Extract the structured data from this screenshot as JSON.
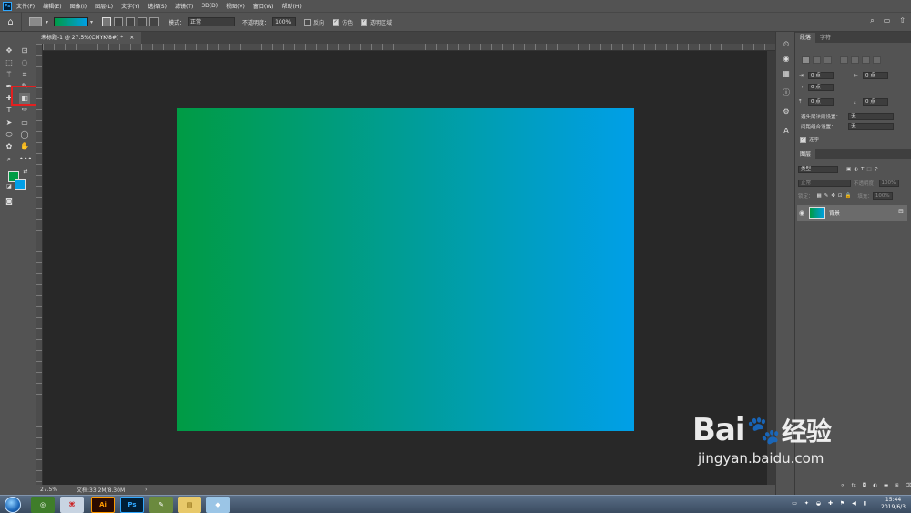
{
  "app": {
    "logo_text": "Ps"
  },
  "menu": [
    "文件(F)",
    "编辑(E)",
    "图像(I)",
    "图层(L)",
    "文字(Y)",
    "选择(S)",
    "滤镜(T)",
    "3D(D)",
    "视图(V)",
    "窗口(W)",
    "帮助(H)"
  ],
  "options": {
    "mode_label": "模式：",
    "mode_value": "正常",
    "opacity_label": "不透明度：",
    "opacity_value": "100%",
    "reverse_label": "反向",
    "dither_label": "仿色",
    "transparency_label": "透明区域",
    "reverse_checked": false,
    "dither_checked": true,
    "transparency_checked": true
  },
  "document": {
    "tab_title": "未标题-1 @ 27.5%(CMYK/8#) *",
    "close_glyph": "×",
    "gradient_start": "#009b44",
    "gradient_end": "#009fe8"
  },
  "status": {
    "zoom": "27.5%",
    "doc_info": "文档:33.2M/8.30M"
  },
  "paragraph_panel": {
    "tabs": [
      "段落",
      "字符"
    ],
    "indent_left": "0 点",
    "indent_right": "0 点",
    "indent_first": "0 点",
    "space_before": "0 点",
    "space_after": "0 点",
    "avoid_label": "避头尾法则设置：",
    "avoid_value": "无",
    "spacing_label": "间距组合设置：",
    "spacing_value": "无",
    "hyphen_label": "连字",
    "hyphen_checked": true
  },
  "layers_panel": {
    "tab": "图层",
    "filter_label": "类型",
    "blend_mode": "正常",
    "opacity_label": "不透明度：",
    "opacity_value": "100%",
    "lock_label": "锁定：",
    "fill_label": "填充：",
    "fill_value": "100%",
    "layer_name": "背景"
  },
  "tools": [
    "move-tool",
    "artboard-tool",
    "marquee-tool",
    "lasso-tool",
    "magic-wand-tool",
    "crop-tool",
    "eyedropper-tool",
    "brush-tool",
    "spot-heal-tool",
    "gradient-tool",
    "type-tool",
    "pen-tool",
    "path-select-tool",
    "rectangle-tool",
    "ellipse-tool",
    "hand-tool",
    "zoom-tool",
    "more-tools"
  ],
  "colors": {
    "foreground": "#009b44",
    "background": "#009fe8"
  },
  "taskbar": {
    "apps": [
      "Ps",
      "Ai"
    ],
    "time": "15:44",
    "date": "2019/6/3"
  },
  "watermark": {
    "brand": "Bai",
    "brand2": "经验",
    "url": "jingyan.baidu.com"
  }
}
